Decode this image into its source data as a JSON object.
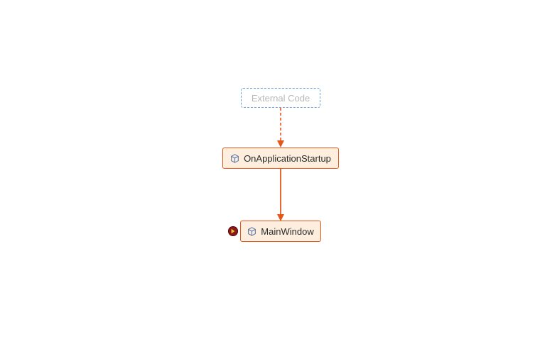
{
  "diagram": {
    "type": "call-stack-map",
    "nodes": {
      "external": {
        "label": "External Code"
      },
      "startup": {
        "label": "OnApplicationStartup"
      },
      "main": {
        "label": "MainWindow"
      }
    },
    "edges": [
      {
        "from": "external",
        "to": "startup",
        "style": "dashed"
      },
      {
        "from": "startup",
        "to": "main",
        "style": "solid"
      }
    ],
    "colors": {
      "edge": "#e4571b",
      "node_border": "#e4571b",
      "node_fill": "#fdeedd",
      "external_border": "#6f9fd8",
      "external_text": "#b8b8b8"
    },
    "breakpoint_on": "main"
  }
}
